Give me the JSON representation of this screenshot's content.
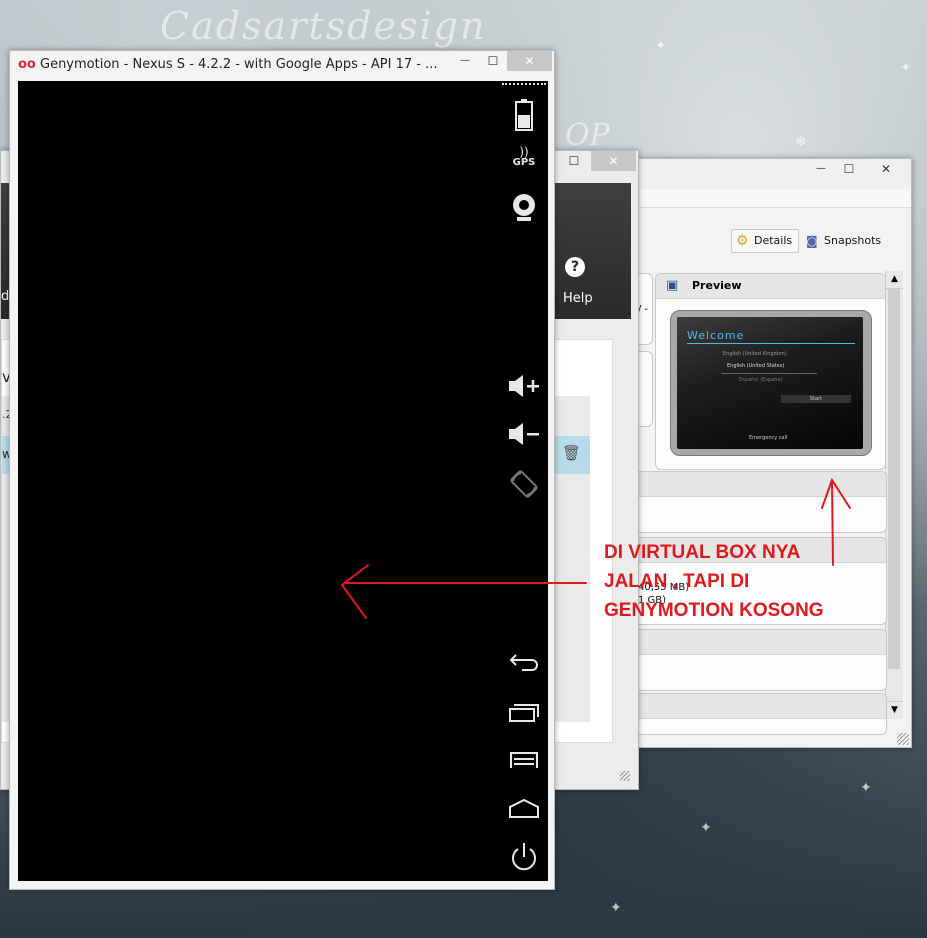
{
  "background": {
    "watermark_top": "Cadsartsdesign",
    "watermark_mid": "OP"
  },
  "genymotion_window": {
    "title": "Genymotion - Nexus S - 4.2.2 - with Google Apps - API 17 - ...",
    "minimize": "—",
    "maximize": "☐",
    "close": "✕",
    "sidebar_labels": {
      "gps": "GPS"
    }
  },
  "launcher_window": {
    "minimize": "—",
    "maximize": "☐",
    "close": "✕",
    "help_label": "Help",
    "partial_left_texts": [
      "d",
      "vi",
      ".2",
      "w"
    ]
  },
  "virtualbox_window": {
    "minimize": "—",
    "maximize": "☐",
    "close": "✕",
    "details_button": "Details",
    "snapshots_button": "Snapshots",
    "preview_title": "Preview",
    "preview_screen": {
      "welcome": "Welcome",
      "lang1": "English (United Kingdom)",
      "lang2": "English (United States)",
      "lang3": "Español (España)",
      "start": "Start",
      "emergency": "Emergency call"
    },
    "memory_text": "40,55 MB)",
    "disk_text": "1 GB)",
    "partial_text": "/ -"
  },
  "annotation": {
    "line1": "DI VIRTUAL BOX NYA",
    "line2": "JALAN , TAPI DI",
    "line3": "GENYMOTION KOSONG",
    "color": "#e0191e"
  }
}
